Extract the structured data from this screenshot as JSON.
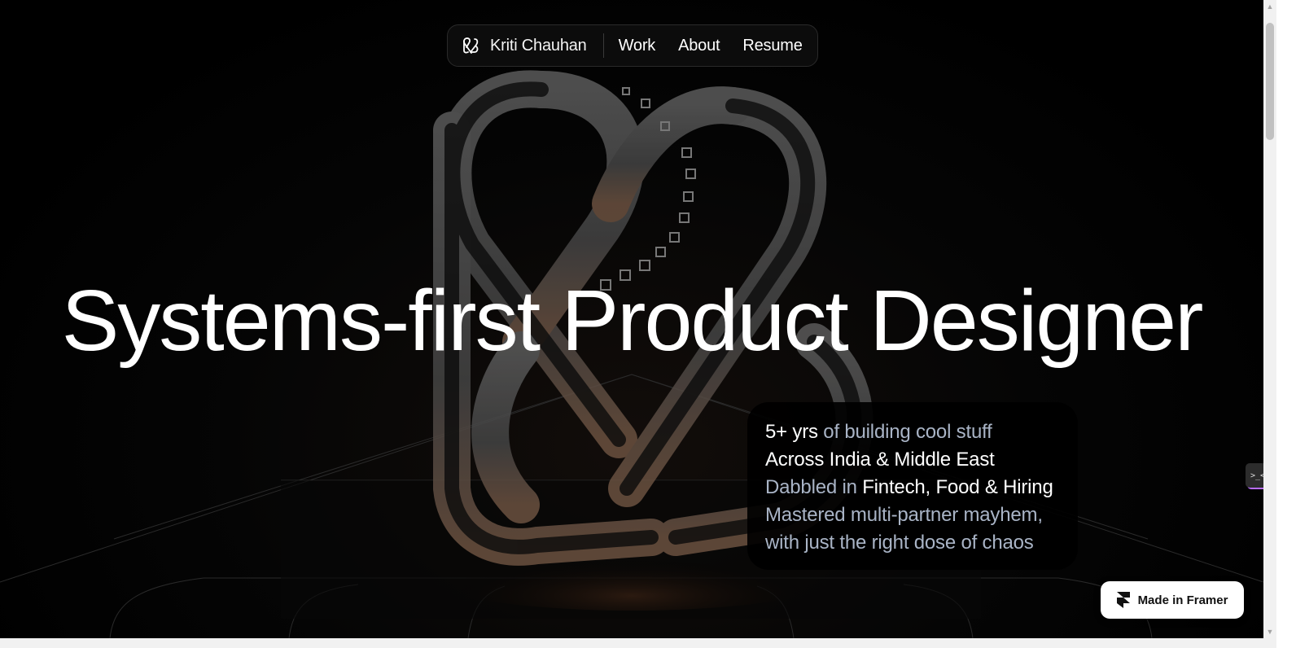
{
  "nav": {
    "brand_name": "Kriti Chauhan",
    "brand_icon": "kc-monogram-icon",
    "links": [
      "Work",
      "About",
      "Resume"
    ]
  },
  "hero": {
    "title": "Systems-first Product Designer"
  },
  "info_card": {
    "line1": {
      "highlight": "5+ yrs",
      "rest": " of building cool stuff"
    },
    "line2": {
      "highlight": "Across India & Middle East"
    },
    "line3": {
      "prefix": "Dabbled in ",
      "highlight": "Fintech, Food & Hiring"
    },
    "line4": {
      "text": "Mastered multi-partner mayhem,"
    },
    "line5": {
      "text": "with just the right dose of chaos"
    }
  },
  "side_widget": {
    "label": ">_<"
  },
  "framer_badge": {
    "label": "Made in Framer",
    "icon": "framer-logo-icon"
  },
  "colors": {
    "background": "#000000",
    "highlight_text": "#ffffff",
    "muted_text": "#a9b4c6",
    "nav_bg": "#0c0c0c"
  }
}
